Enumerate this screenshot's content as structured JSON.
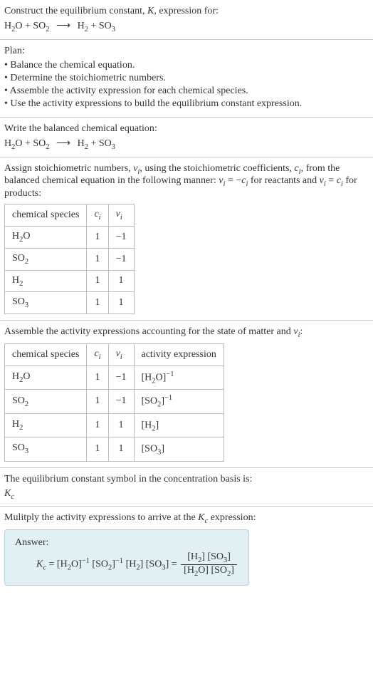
{
  "intro": {
    "line1": "Construct the equilibrium constant, ",
    "Ksym": "K",
    "line1b": ", expression for:",
    "equation_lhs1": "H",
    "equation_lhs1_sub": "2",
    "equation_lhs1b": "O + SO",
    "equation_lhs1b_sub": "2",
    "arrow": "⟶",
    "equation_rhs1": "H",
    "equation_rhs1_sub": "2",
    "equation_rhs1b": " + SO",
    "equation_rhs1b_sub": "3"
  },
  "plan": {
    "title": "Plan:",
    "items": [
      "• Balance the chemical equation.",
      "• Determine the stoichiometric numbers.",
      "• Assemble the activity expression for each chemical species.",
      "• Use the activity expressions to build the equilibrium constant expression."
    ]
  },
  "balanced": {
    "title": "Write the balanced chemical equation:"
  },
  "stoich_intro": {
    "a": "Assign stoichiometric numbers, ",
    "nu": "ν",
    "nu_sub": "i",
    "b": ", using the stoichiometric coefficients, ",
    "c": "c",
    "c_sub": "i",
    "d": ", from the balanced chemical equation in the following manner: ",
    "eq1a": "ν",
    "eq1a_sub": "i",
    "eq1b": " = −",
    "eq1c": "c",
    "eq1c_sub": "i",
    "e": " for reactants and ",
    "eq2a": "ν",
    "eq2a_sub": "i",
    "eq2b": " = ",
    "eq2c": "c",
    "eq2c_sub": "i",
    "f": " for products:"
  },
  "table1": {
    "h1": "chemical species",
    "h2": "c",
    "h2_sub": "i",
    "h3": "ν",
    "h3_sub": "i",
    "rows": [
      {
        "sp_a": "H",
        "sp_asub": "2",
        "sp_b": "O",
        "c": "1",
        "nu": "−1"
      },
      {
        "sp_a": "SO",
        "sp_asub": "2",
        "sp_b": "",
        "c": "1",
        "nu": "−1"
      },
      {
        "sp_a": "H",
        "sp_asub": "2",
        "sp_b": "",
        "c": "1",
        "nu": "1"
      },
      {
        "sp_a": "SO",
        "sp_asub": "3",
        "sp_b": "",
        "c": "1",
        "nu": "1"
      }
    ]
  },
  "assemble": {
    "a": "Assemble the activity expressions accounting for the state of matter and ",
    "nu": "ν",
    "nu_sub": "i",
    "b": ":"
  },
  "table2": {
    "h1": "chemical species",
    "h2": "c",
    "h2_sub": "i",
    "h3": "ν",
    "h3_sub": "i",
    "h4": "activity expression",
    "rows": [
      {
        "sp_a": "H",
        "sp_asub": "2",
        "sp_b": "O",
        "c": "1",
        "nu": "−1",
        "act_a": "[H",
        "act_asub": "2",
        "act_b": "O]",
        "act_sup": "−1"
      },
      {
        "sp_a": "SO",
        "sp_asub": "2",
        "sp_b": "",
        "c": "1",
        "nu": "−1",
        "act_a": "[SO",
        "act_asub": "2",
        "act_b": "]",
        "act_sup": "−1"
      },
      {
        "sp_a": "H",
        "sp_asub": "2",
        "sp_b": "",
        "c": "1",
        "nu": "1",
        "act_a": "[H",
        "act_asub": "2",
        "act_b": "]",
        "act_sup": ""
      },
      {
        "sp_a": "SO",
        "sp_asub": "3",
        "sp_b": "",
        "c": "1",
        "nu": "1",
        "act_a": "[SO",
        "act_asub": "3",
        "act_b": "]",
        "act_sup": ""
      }
    ]
  },
  "basis": {
    "line1": "The equilibrium constant symbol in the concentration basis is:",
    "K": "K",
    "K_sub": "c"
  },
  "multiply": {
    "a": "Mulitply the activity expressions to arrive at the ",
    "K": "K",
    "K_sub": "c",
    "b": " expression:"
  },
  "answer": {
    "label": "Answer:",
    "K": "K",
    "K_sub": "c",
    "eq": " = ",
    "t1a": "[H",
    "t1asub": "2",
    "t1b": "O]",
    "t1sup": "−1",
    "sp": " ",
    "t2a": "[SO",
    "t2asub": "2",
    "t2b": "]",
    "t2sup": "−1",
    "t3a": "[H",
    "t3asub": "2",
    "t3b": "]",
    "t4a": "[SO",
    "t4asub": "3",
    "t4b": "]",
    "eq2": " = ",
    "numa": "[H",
    "numasub": "2",
    "numb": "] [SO",
    "numbsub": "3",
    "numc": "]",
    "dena": "[H",
    "denasub": "2",
    "denb": "O] [SO",
    "denbsub": "2",
    "denc": "]"
  },
  "chart_data": {
    "type": "table",
    "tables": [
      {
        "columns": [
          "chemical species",
          "c_i",
          "ν_i"
        ],
        "rows": [
          [
            "H2O",
            "1",
            "-1"
          ],
          [
            "SO2",
            "1",
            "-1"
          ],
          [
            "H2",
            "1",
            "1"
          ],
          [
            "SO3",
            "1",
            "1"
          ]
        ]
      },
      {
        "columns": [
          "chemical species",
          "c_i",
          "ν_i",
          "activity expression"
        ],
        "rows": [
          [
            "H2O",
            "1",
            "-1",
            "[H2O]^-1"
          ],
          [
            "SO2",
            "1",
            "-1",
            "[SO2]^-1"
          ],
          [
            "H2",
            "1",
            "1",
            "[H2]"
          ],
          [
            "SO3",
            "1",
            "1",
            "[SO3]"
          ]
        ]
      }
    ]
  }
}
